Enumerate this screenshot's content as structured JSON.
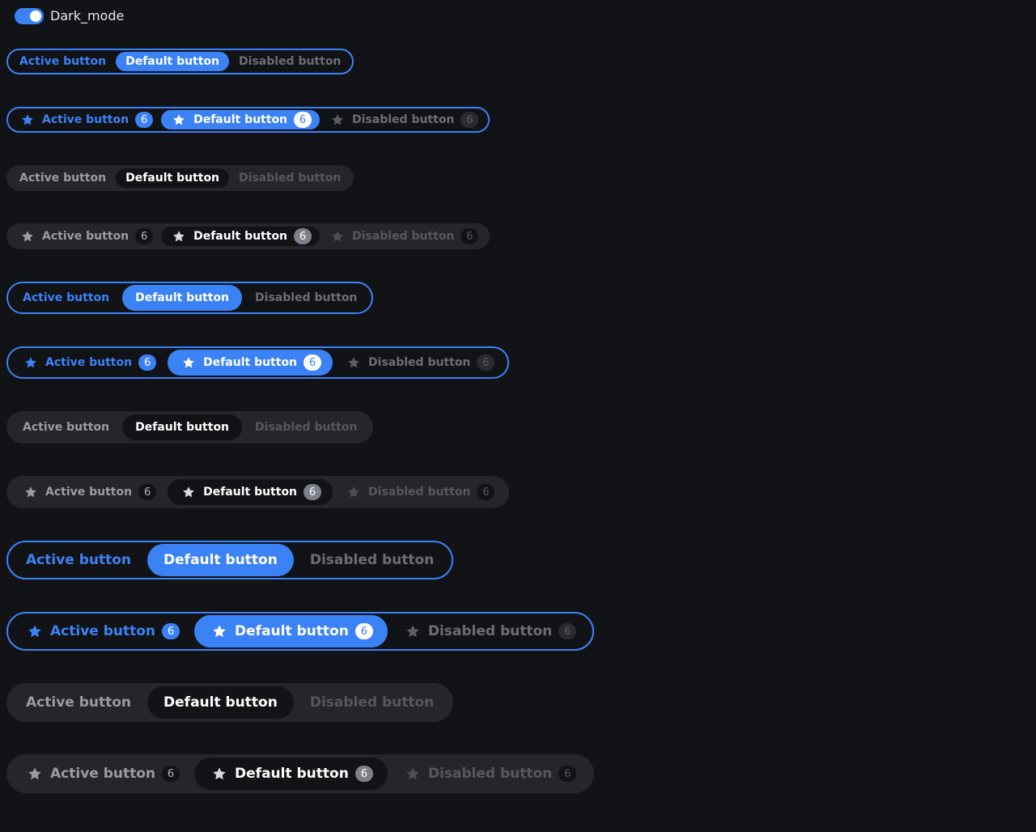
{
  "toggle": {
    "label": "Dark_mode",
    "on": true
  },
  "accent": "#3b82f6",
  "background": "#121317",
  "icon": "star-icon",
  "buttons": {
    "active": "Active button",
    "default": "Default button",
    "disabled": "Disabled button",
    "badge": "6"
  }
}
